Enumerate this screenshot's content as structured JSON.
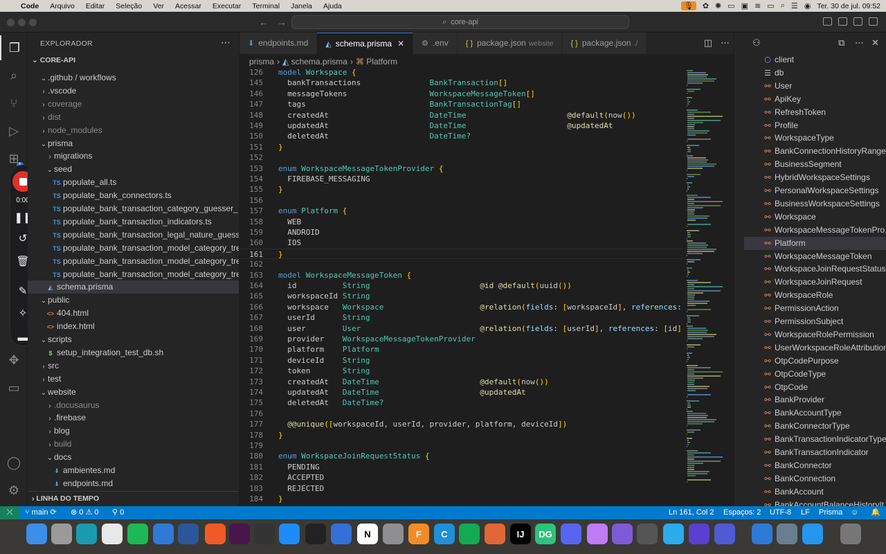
{
  "menubar": {
    "items": [
      "Code",
      "Arquivo",
      "Editar",
      "Seleção",
      "Ver",
      "Acessar",
      "Executar",
      "Terminal",
      "Janela",
      "Ajuda"
    ],
    "clock": "Ter. 30 de jul.  09:52"
  },
  "titlebar": {
    "search": "core-api"
  },
  "recorder": {
    "time": "0:00"
  },
  "explorer": {
    "title": "EXPLORADOR",
    "root": "CORE-API",
    "tree": [
      {
        "label": ".github / workflows",
        "kind": "folder-open",
        "depth": 1
      },
      {
        "label": ".vscode",
        "kind": "folder",
        "depth": 1
      },
      {
        "label": "coverage",
        "kind": "folder",
        "depth": 1,
        "dim": true
      },
      {
        "label": "dist",
        "kind": "folder",
        "depth": 1,
        "dim": true
      },
      {
        "label": "node_modules",
        "kind": "folder",
        "depth": 1,
        "dim": true
      },
      {
        "label": "prisma",
        "kind": "folder-open",
        "depth": 1
      },
      {
        "label": "migrations",
        "kind": "folder",
        "depth": 2
      },
      {
        "label": "seed",
        "kind": "folder-open",
        "depth": 2
      },
      {
        "label": "populate_all.ts",
        "kind": "ts",
        "depth": 3
      },
      {
        "label": "populate_bank_connectors.ts",
        "kind": "ts",
        "depth": 3
      },
      {
        "label": "populate_bank_transaction_category_guesser_...",
        "kind": "ts",
        "depth": 3
      },
      {
        "label": "populate_bank_transaction_indicators.ts",
        "kind": "ts",
        "depth": 3
      },
      {
        "label": "populate_bank_transaction_legal_nature_guess...",
        "kind": "ts",
        "depth": 3
      },
      {
        "label": "populate_bank_transaction_model_category_tre...",
        "kind": "ts",
        "depth": 3
      },
      {
        "label": "populate_bank_transaction_model_category_tre...",
        "kind": "ts",
        "depth": 3
      },
      {
        "label": "populate_bank_transaction_model_category_tre...",
        "kind": "ts",
        "depth": 3
      },
      {
        "label": "schema.prisma",
        "kind": "prisma",
        "depth": 2,
        "selected": true
      },
      {
        "label": "public",
        "kind": "folder-open",
        "depth": 1
      },
      {
        "label": "404.html",
        "kind": "html",
        "depth": 2
      },
      {
        "label": "index.html",
        "kind": "html",
        "depth": 2
      },
      {
        "label": "scripts",
        "kind": "folder-open",
        "depth": 1
      },
      {
        "label": "setup_integration_test_db.sh",
        "kind": "sh",
        "depth": 2
      },
      {
        "label": "src",
        "kind": "folder",
        "depth": 1
      },
      {
        "label": "test",
        "kind": "folder",
        "depth": 1
      },
      {
        "label": "website",
        "kind": "folder-open",
        "depth": 1
      },
      {
        "label": ".docusaurus",
        "kind": "folder",
        "depth": 2,
        "dim": true
      },
      {
        "label": ".firebase",
        "kind": "folder",
        "depth": 2
      },
      {
        "label": "blog",
        "kind": "folder",
        "depth": 2
      },
      {
        "label": "build",
        "kind": "folder",
        "depth": 2,
        "dim": true
      },
      {
        "label": "docs",
        "kind": "folder-open",
        "depth": 2
      },
      {
        "label": "ambientes.md",
        "kind": "md",
        "depth": 3
      },
      {
        "label": "endpoints.md",
        "kind": "md",
        "depth": 3
      }
    ],
    "timeline": "LINHA DO TEMPO"
  },
  "tabs": [
    {
      "label": "endpoints.md",
      "icon": "md",
      "sub": ""
    },
    {
      "label": "schema.prisma",
      "icon": "prisma",
      "sub": "",
      "active": true
    },
    {
      "label": ".env",
      "icon": "gear",
      "sub": ""
    },
    {
      "label": "package.json",
      "icon": "json",
      "sub": "website"
    },
    {
      "label": "package.json",
      "icon": "json",
      "sub": "./"
    }
  ],
  "breadcrumb": [
    "prisma",
    "schema.prisma",
    "Platform"
  ],
  "code": {
    "current_line": 161,
    "lines": [
      {
        "n": "126",
        "text": "model Workspace {"
      },
      {
        "n": "145",
        "text": "  bankTransactions               BankTransaction[]"
      },
      {
        "n": "146",
        "text": "  messageTokens                  WorkspaceMessageToken[]"
      },
      {
        "n": "147",
        "text": "  tags                           BankTransactionTag[]"
      },
      {
        "n": "148",
        "text": "  createdAt                      DateTime                      @default(now())"
      },
      {
        "n": "149",
        "text": "  updatedAt                      DateTime                      @updatedAt"
      },
      {
        "n": "150",
        "text": "  deletedAt                      DateTime?"
      },
      {
        "n": "151",
        "text": "}"
      },
      {
        "n": "152",
        "text": ""
      },
      {
        "n": "153",
        "text": "enum WorkspaceMessageTokenProvider {"
      },
      {
        "n": "154",
        "text": "  FIREBASE_MESSAGING"
      },
      {
        "n": "155",
        "text": "}"
      },
      {
        "n": "156",
        "text": ""
      },
      {
        "n": "157",
        "text": "enum Platform {"
      },
      {
        "n": "158",
        "text": "  WEB"
      },
      {
        "n": "159",
        "text": "  ANDROID"
      },
      {
        "n": "160",
        "text": "  IOS"
      },
      {
        "n": "161",
        "text": "}"
      },
      {
        "n": "162",
        "text": ""
      },
      {
        "n": "163",
        "text": "model WorkspaceMessageToken {"
      },
      {
        "n": "164",
        "text": "  id          String                        @id @default(uuid())"
      },
      {
        "n": "165",
        "text": "  workspaceId String"
      },
      {
        "n": "166",
        "text": "  workspace   Workspace                     @relation(fields: [workspaceId], references: [id],"
      },
      {
        "n": "167",
        "text": "  userId      String"
      },
      {
        "n": "168",
        "text": "  user        User                          @relation(fields: [userId], references: [id])"
      },
      {
        "n": "169",
        "text": "  provider    WorkspaceMessageTokenProvider"
      },
      {
        "n": "170",
        "text": "  platform    Platform"
      },
      {
        "n": "171",
        "text": "  deviceId    String"
      },
      {
        "n": "172",
        "text": "  token       String"
      },
      {
        "n": "173",
        "text": "  createdAt   DateTime                      @default(now())"
      },
      {
        "n": "174",
        "text": "  updatedAt   DateTime                      @updatedAt"
      },
      {
        "n": "175",
        "text": "  deletedAt   DateTime?"
      },
      {
        "n": "176",
        "text": ""
      },
      {
        "n": "177",
        "text": "  @@unique([workspaceId, userId, provider, platform, deviceId])"
      },
      {
        "n": "178",
        "text": "}"
      },
      {
        "n": "179",
        "text": ""
      },
      {
        "n": "180",
        "text": "enum WorkspaceJoinRequestStatus {"
      },
      {
        "n": "181",
        "text": "  PENDING"
      },
      {
        "n": "182",
        "text": "  ACCEPTED"
      },
      {
        "n": "183",
        "text": "  REJECTED"
      },
      {
        "n": "184",
        "text": "}"
      }
    ]
  },
  "outline": {
    "items": [
      {
        "label": "client",
        "icon": "cube"
      },
      {
        "label": "db",
        "icon": "db"
      },
      {
        "label": "User",
        "icon": "class"
      },
      {
        "label": "ApiKey",
        "icon": "class"
      },
      {
        "label": "RefreshToken",
        "icon": "class"
      },
      {
        "label": "Profile",
        "icon": "class"
      },
      {
        "label": "WorkspaceType",
        "icon": "class"
      },
      {
        "label": "BankConnectionHistoryRange",
        "icon": "class"
      },
      {
        "label": "BusinessSegment",
        "icon": "class"
      },
      {
        "label": "HybridWorkspaceSettings",
        "icon": "class"
      },
      {
        "label": "PersonalWorkspaceSettings",
        "icon": "class"
      },
      {
        "label": "BusinessWorkspaceSettings",
        "icon": "class"
      },
      {
        "label": "Workspace",
        "icon": "class"
      },
      {
        "label": "WorkspaceMessageTokenPro...",
        "icon": "class"
      },
      {
        "label": "Platform",
        "icon": "class",
        "selected": true
      },
      {
        "label": "WorkspaceMessageToken",
        "icon": "class"
      },
      {
        "label": "WorkspaceJoinRequestStatus",
        "icon": "class"
      },
      {
        "label": "WorkspaceJoinRequest",
        "icon": "class"
      },
      {
        "label": "WorkspaceRole",
        "icon": "class"
      },
      {
        "label": "PermissionAction",
        "icon": "class"
      },
      {
        "label": "PermissionSubject",
        "icon": "class"
      },
      {
        "label": "WorkspaceRolePermission",
        "icon": "class"
      },
      {
        "label": "UserWorkspaceRoleAttribution",
        "icon": "class"
      },
      {
        "label": "OtpCodePurpose",
        "icon": "class"
      },
      {
        "label": "OtpCodeType",
        "icon": "class"
      },
      {
        "label": "OtpCode",
        "icon": "class"
      },
      {
        "label": "BankProvider",
        "icon": "class"
      },
      {
        "label": "BankAccountType",
        "icon": "class"
      },
      {
        "label": "BankConnectorType",
        "icon": "class"
      },
      {
        "label": "BankTransactionIndicatorType",
        "icon": "class"
      },
      {
        "label": "BankTransactionIndicator",
        "icon": "class"
      },
      {
        "label": "BankConnector",
        "icon": "class"
      },
      {
        "label": "BankConnection",
        "icon": "class"
      },
      {
        "label": "BankAccount",
        "icon": "class"
      },
      {
        "label": "BankAccountBalanceHistoryIt...",
        "icon": "class"
      }
    ]
  },
  "statusbar": {
    "branch": "main",
    "problems": "⊗ 0 ⚠ 0",
    "ports": "⚲ 0",
    "position": "Ln 161, Col 2",
    "spaces": "Espaços: 2",
    "encoding": "UTF-8",
    "eol": "LF",
    "language": "Prisma"
  },
  "dock": {
    "apps": [
      "finder",
      "launchpad",
      "terminal-alt",
      "chrome",
      "spotify",
      "vscode",
      "word",
      "pencil",
      "slack",
      "inkscape",
      "app-store",
      "activity-monitor",
      "xcode",
      "notion",
      "settings",
      "f360",
      "c-app",
      "mongodb",
      "matlab",
      "intellij",
      "datagrip",
      "discord",
      "lens",
      "navi",
      "unity",
      "telegram",
      "rewind",
      "cluster",
      "vscode-2",
      "preview",
      "docker",
      "trash"
    ],
    "labels": {
      "f360": "F",
      "intellij": "IJ",
      "datagrip": "DG",
      "notion": "N",
      "c-app": "C"
    }
  },
  "colors": {
    "accent": "#007acc",
    "remote": "#16825d",
    "keyword": "#569cd6",
    "type": "#4ec9b0",
    "attr": "#dcdcaa",
    "record": "#e0302a"
  }
}
